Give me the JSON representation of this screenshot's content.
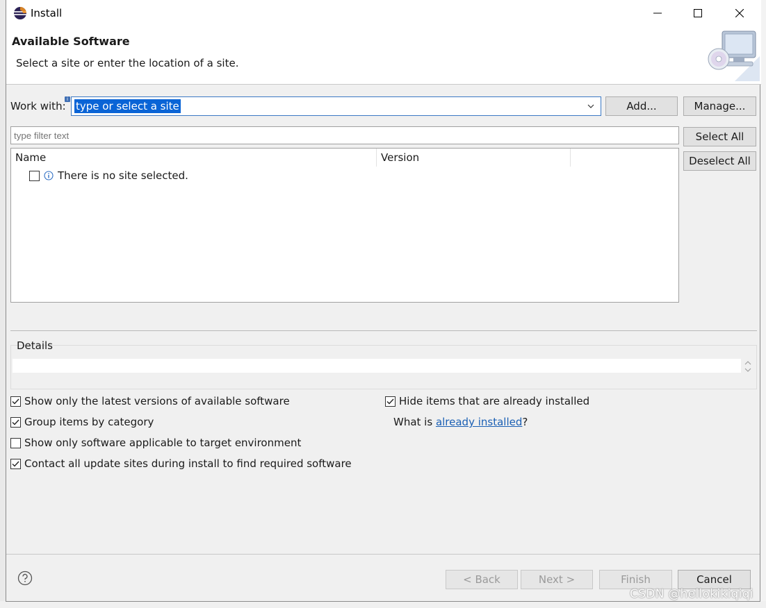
{
  "window": {
    "title": "Install"
  },
  "header": {
    "title": "Available Software",
    "subtitle": "Select a site or enter the location of a site."
  },
  "work_with": {
    "label": "Work with:",
    "value": "type or select a site",
    "add_label": "Add...",
    "manage_label": "Manage..."
  },
  "filter": {
    "placeholder": "type filter text"
  },
  "buttons_side": {
    "select_all": "Select All",
    "deselect_all": "Deselect All"
  },
  "table": {
    "columns": [
      "Name",
      "Version"
    ],
    "rows": [
      {
        "checked": false,
        "text": "There is no site selected."
      }
    ]
  },
  "details": {
    "label": "Details",
    "text": ""
  },
  "options": {
    "latest": {
      "label": "Show only the latest versions of available software",
      "checked": true
    },
    "group": {
      "label": "Group items by category",
      "checked": true
    },
    "target": {
      "label": "Show only software applicable to target environment",
      "checked": false
    },
    "contact": {
      "label": "Contact all update sites during install to find required software",
      "checked": true
    },
    "hide": {
      "label": "Hide items that are already installed",
      "checked": true
    }
  },
  "installed_query": {
    "prefix": "What is ",
    "link": "already installed",
    "suffix": "?"
  },
  "footer": {
    "back": "< Back",
    "next": "Next >",
    "finish": "Finish",
    "cancel": "Cancel"
  },
  "watermark": "CSDN @hellokikiqiqi",
  "colors": {
    "accent": "#0a64d6",
    "link": "#1a5fb4",
    "dialog_bg": "#f0f0f0"
  },
  "icons": {
    "app": "eclipse-icon",
    "banner": "install-monitor-cd-icon",
    "help": "help-icon",
    "info": "info-icon"
  }
}
